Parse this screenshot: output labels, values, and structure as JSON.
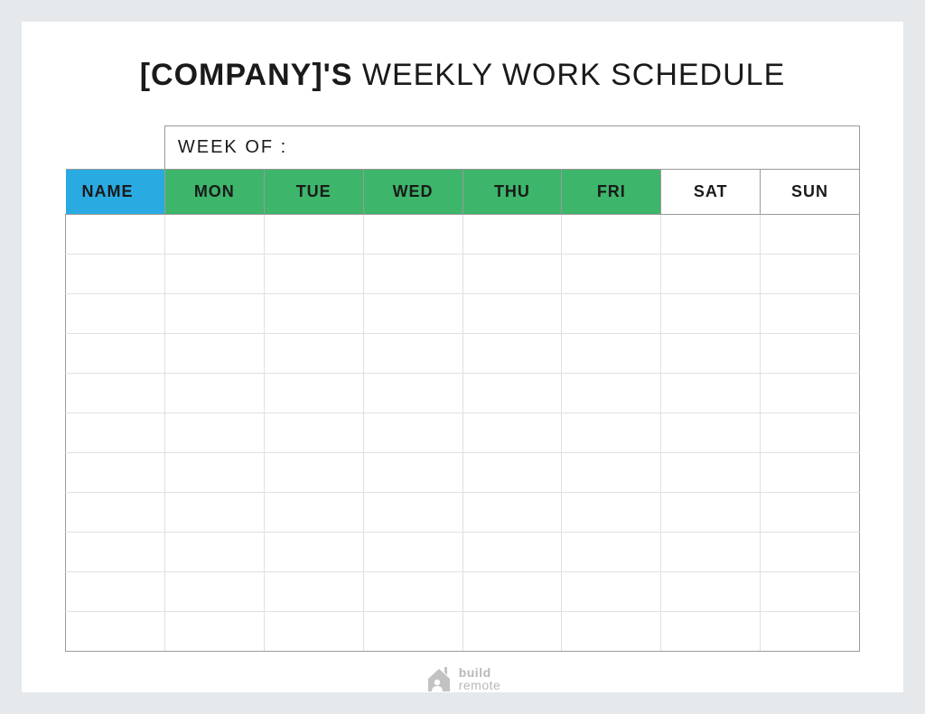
{
  "title": {
    "bold": "[COMPANY]'S",
    "light": "WEEKLY WORK SCHEDULE"
  },
  "week_of_label": "WEEK OF :",
  "headers": {
    "name": "NAME",
    "days": [
      "MON",
      "TUE",
      "WED",
      "THU",
      "FRI",
      "SAT",
      "SUN"
    ]
  },
  "rows": [
    "",
    "",
    "",
    "",
    "",
    "",
    "",
    "",
    "",
    "",
    ""
  ],
  "footer": {
    "line1": "build",
    "line2": "remote"
  }
}
